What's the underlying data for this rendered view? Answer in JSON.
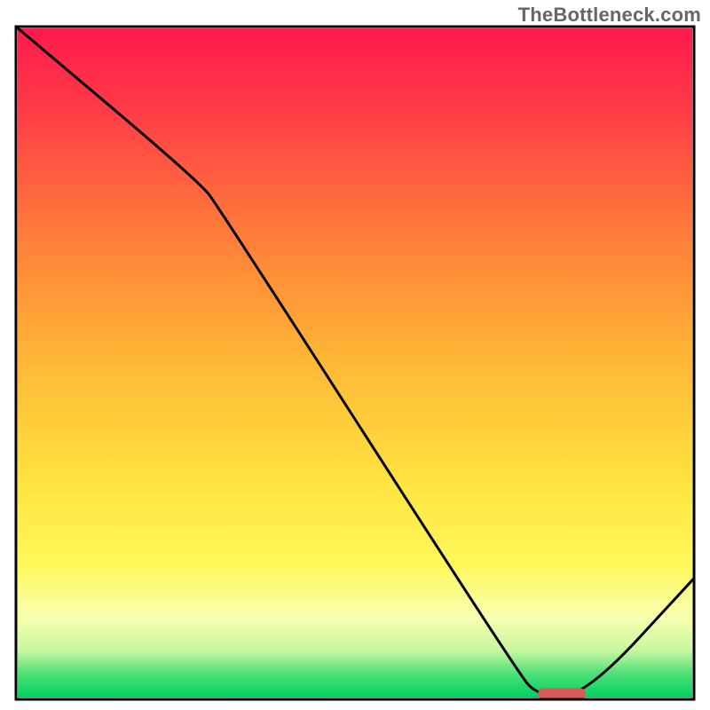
{
  "watermark": "TheBottleneck.com",
  "chart_data": {
    "type": "line",
    "title": "",
    "xlabel": "",
    "ylabel": "",
    "x_range": [
      0,
      100
    ],
    "y_range": [
      0,
      100
    ],
    "series": [
      {
        "name": "curve",
        "points": [
          {
            "x": 0,
            "y": 100
          },
          {
            "x": 27,
            "y": 77
          },
          {
            "x": 30,
            "y": 73
          },
          {
            "x": 74,
            "y": 4
          },
          {
            "x": 77,
            "y": 0.5
          },
          {
            "x": 84,
            "y": 0.5
          },
          {
            "x": 100,
            "y": 18
          }
        ]
      }
    ],
    "marker": {
      "x_start": 77,
      "x_end": 84,
      "y": 0.8,
      "color": "#d85a5a"
    },
    "gradient_stops": [
      {
        "offset": 0.0,
        "color": "#ff1a4d"
      },
      {
        "offset": 0.12,
        "color": "#ff3b47"
      },
      {
        "offset": 0.3,
        "color": "#ff7a3a"
      },
      {
        "offset": 0.5,
        "color": "#ffb836"
      },
      {
        "offset": 0.68,
        "color": "#ffe440"
      },
      {
        "offset": 0.8,
        "color": "#fff85a"
      },
      {
        "offset": 0.88,
        "color": "#f8ffb0"
      },
      {
        "offset": 0.93,
        "color": "#c8f7a0"
      },
      {
        "offset": 0.965,
        "color": "#4ce077"
      },
      {
        "offset": 1.0,
        "color": "#00d060"
      }
    ],
    "frame_color": "#000000",
    "curve_color": "#000000",
    "curve_width": 3
  }
}
